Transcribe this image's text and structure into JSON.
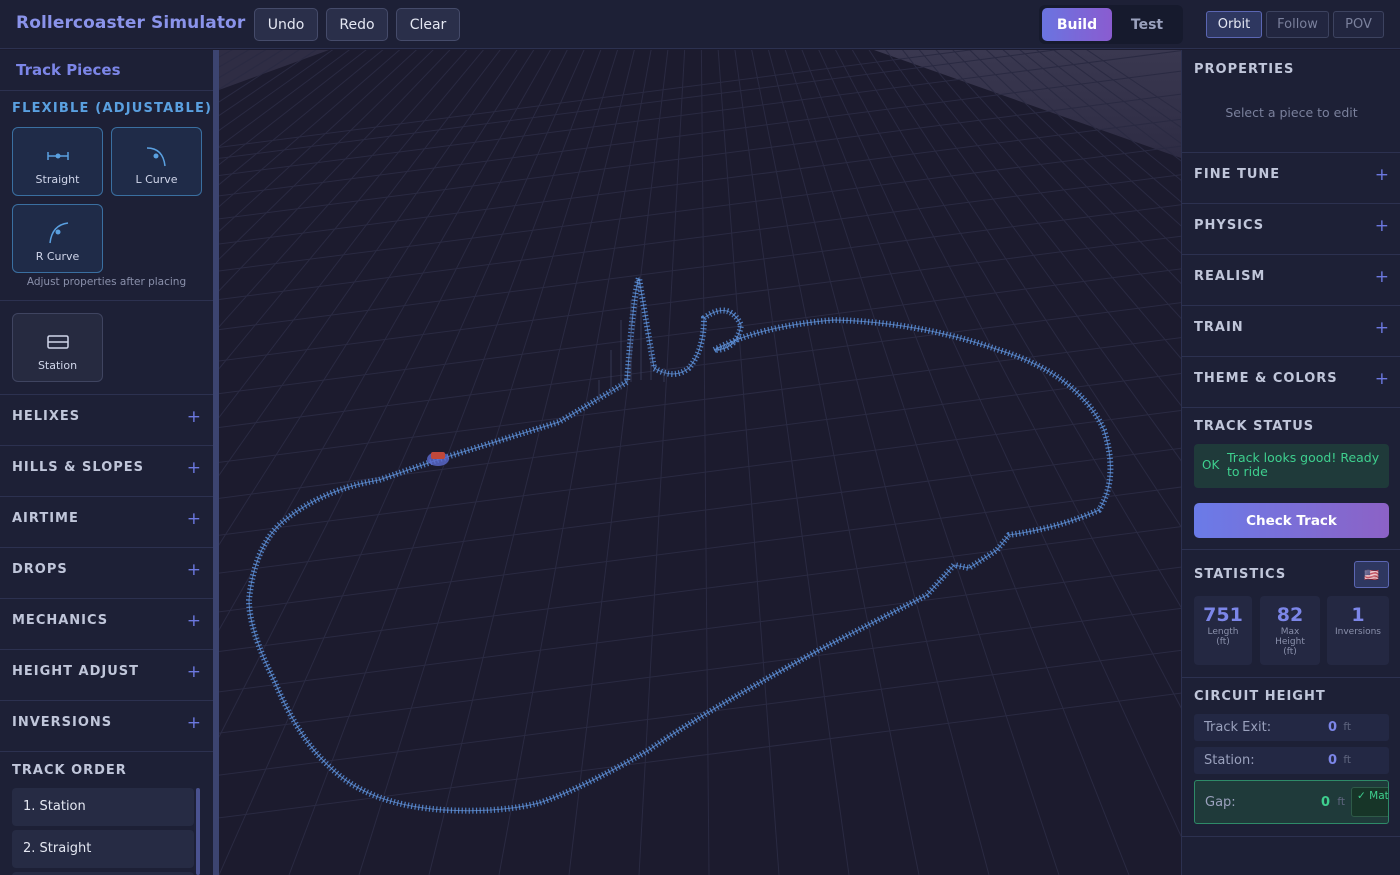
{
  "header": {
    "title": "Rollercoaster Simulator",
    "undo": "Undo",
    "redo": "Redo",
    "clear": "Clear",
    "mode_build": "Build",
    "mode_test": "Test",
    "cam_orbit": "Orbit",
    "cam_follow": "Follow",
    "cam_pov": "POV"
  },
  "left": {
    "title": "Track Pieces",
    "flexible_title": "FLEXIBLE (ADJUSTABLE)",
    "pieces": [
      {
        "label": "Straight",
        "icon": "straight-track-icon"
      },
      {
        "label": "L Curve",
        "icon": "left-curve-icon"
      },
      {
        "label": "R Curve",
        "icon": "right-curve-icon"
      }
    ],
    "flexible_note": "Adjust properties after placing",
    "station": {
      "label": "Station",
      "icon": "station-icon"
    },
    "categories": [
      "HELIXES",
      "HILLS & SLOPES",
      "AIRTIME",
      "DROPS",
      "MECHANICS",
      "HEIGHT ADJUST",
      "INVERSIONS"
    ],
    "track_order_title": "TRACK ORDER",
    "track_order": [
      "1. Station",
      "2. Straight"
    ]
  },
  "right": {
    "properties_title": "PROPERTIES",
    "properties_hint": "Select a piece to edit",
    "sections": [
      "FINE TUNE",
      "PHYSICS",
      "REALISM",
      "TRAIN",
      "THEME & COLORS"
    ],
    "track_status_title": "TRACK STATUS",
    "status_ok": "OK",
    "status_message": "Track looks good! Ready to ride",
    "check_track": "Check Track",
    "statistics_title": "STATISTICS",
    "flag": "🇺🇸",
    "stats": [
      {
        "value": "751",
        "label": "Length (ft)"
      },
      {
        "value": "82",
        "label": "Max Height (ft)"
      },
      {
        "value": "1",
        "label": "Inversions"
      }
    ],
    "circuit_title": "CIRCUIT HEIGHT",
    "track_exit_label": "Track Exit:",
    "track_exit_value": "0",
    "station_label": "Station:",
    "station_value": "0",
    "gap_label": "Gap:",
    "gap_value": "0",
    "unit": "ft",
    "matched": "✓ Matched"
  },
  "colors": {
    "accent": "#7c86e8",
    "track": "#5b8fd8",
    "ok": "#3ecf8e"
  }
}
